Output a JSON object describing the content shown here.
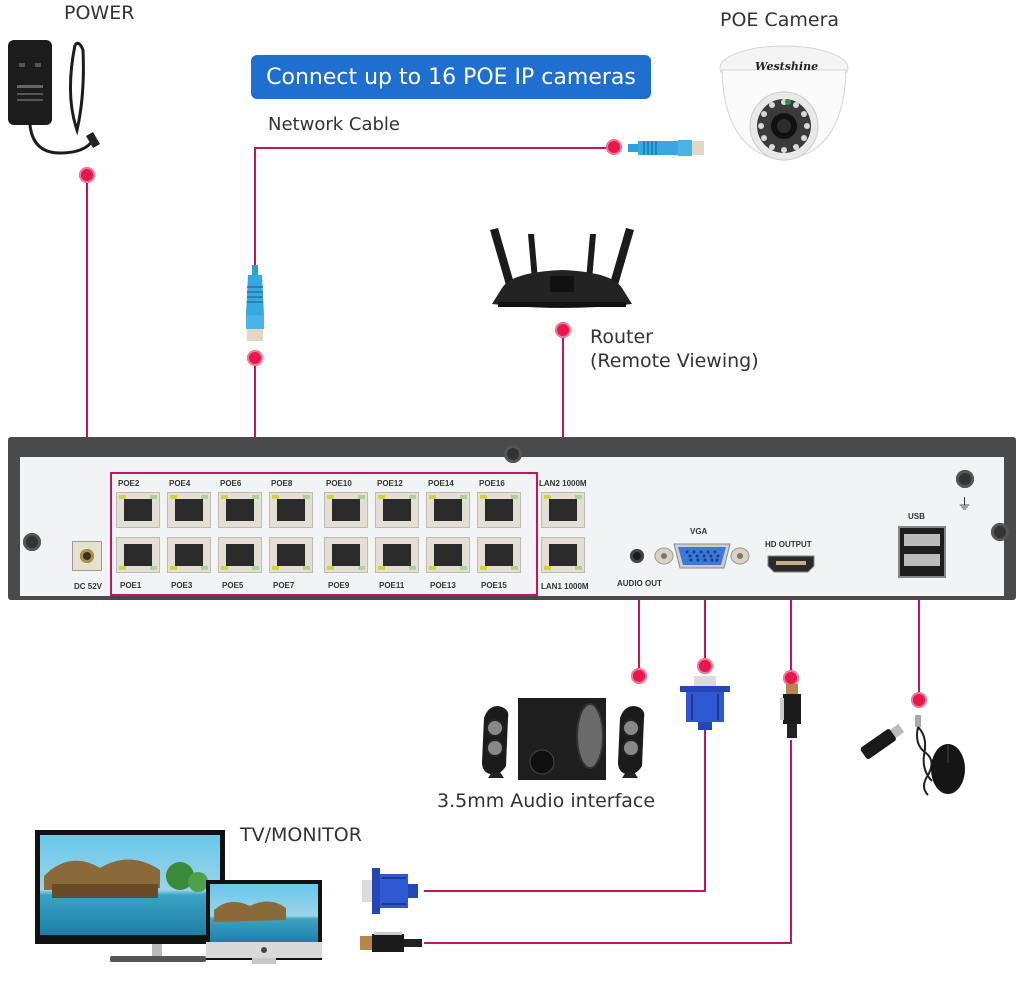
{
  "title": "Connect up to 16 POE IP cameras",
  "labels": {
    "power": "POWER",
    "poe_camera": "POE Camera",
    "camera_brand": "Westshine",
    "network_cable": "Network Cable",
    "router_line1": "Router",
    "router_line2": "(Remote Viewing)",
    "audio": "3.5mm Audio interface",
    "tv_monitor": "TV/MONITOR"
  },
  "nvr": {
    "dc_label": "DC 52V",
    "poe_top": [
      "POE2",
      "POE4",
      "POE6",
      "POE8",
      "POE10",
      "POE12",
      "POE14",
      "POE16"
    ],
    "poe_bottom": [
      "POE1",
      "POE3",
      "POE5",
      "POE7",
      "POE9",
      "POE11",
      "POE13",
      "POE15"
    ],
    "lan2": "LAN2 1000M",
    "lan1": "LAN1 1000M",
    "audio_out": "AUDIO OUT",
    "vga": "VGA",
    "hd_output": "HD OUTPUT",
    "usb": "USB",
    "ground_symbol": "⏚"
  },
  "colors": {
    "connector_line": "#c2185b",
    "connector_dot": "#e8174d",
    "banner": "#1e6fd0"
  }
}
